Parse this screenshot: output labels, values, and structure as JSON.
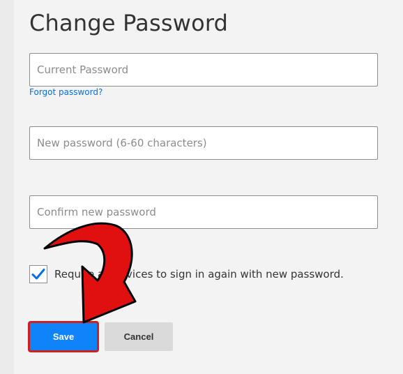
{
  "page": {
    "title": "Change Password"
  },
  "form": {
    "current_password": {
      "placeholder": "Current Password",
      "value": ""
    },
    "forgot_link": "Forgot password?",
    "new_password": {
      "placeholder": "New password (6-60 characters)",
      "value": ""
    },
    "confirm_password": {
      "placeholder": "Confirm new password",
      "value": ""
    },
    "require_signin": {
      "label": "Require all devices to sign in again with new password.",
      "checked": true
    },
    "save_label": "Save",
    "cancel_label": "Cancel"
  },
  "colors": {
    "accent": "#0071eb",
    "save_button": "#0f84fa",
    "annotation_arrow": "#e01010"
  },
  "icons": {
    "checkbox": "checkmark-icon",
    "annotation": "curved-arrow-icon"
  }
}
